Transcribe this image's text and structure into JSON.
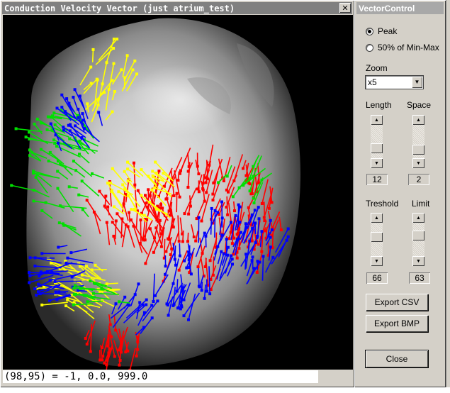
{
  "main_window": {
    "title": "Conduction Velocity Vector (just atrium_test)",
    "close_glyph": "✕",
    "status": "(98,95) = -1, 0.0, 999.0"
  },
  "vector_control": {
    "title": "VectorControl",
    "mode_options": [
      {
        "label": "Peak",
        "selected": true
      },
      {
        "label": "50% of Min-Max",
        "selected": false
      }
    ],
    "zoom": {
      "label": "Zoom",
      "value": "x5"
    },
    "length": {
      "label": "Length",
      "value": "12"
    },
    "space": {
      "label": "Space",
      "value": "2"
    },
    "threshold": {
      "label": "Treshold",
      "value": "66"
    },
    "limit": {
      "label": "Limit",
      "value": "63"
    },
    "export_csv_label": "Export CSV",
    "export_bmp_label": "Export BMP",
    "close_label": "Close"
  },
  "vector_colors": {
    "red": "#ff0000",
    "blue": "#0000ff",
    "green": "#00e000",
    "yellow": "#ffff00"
  }
}
